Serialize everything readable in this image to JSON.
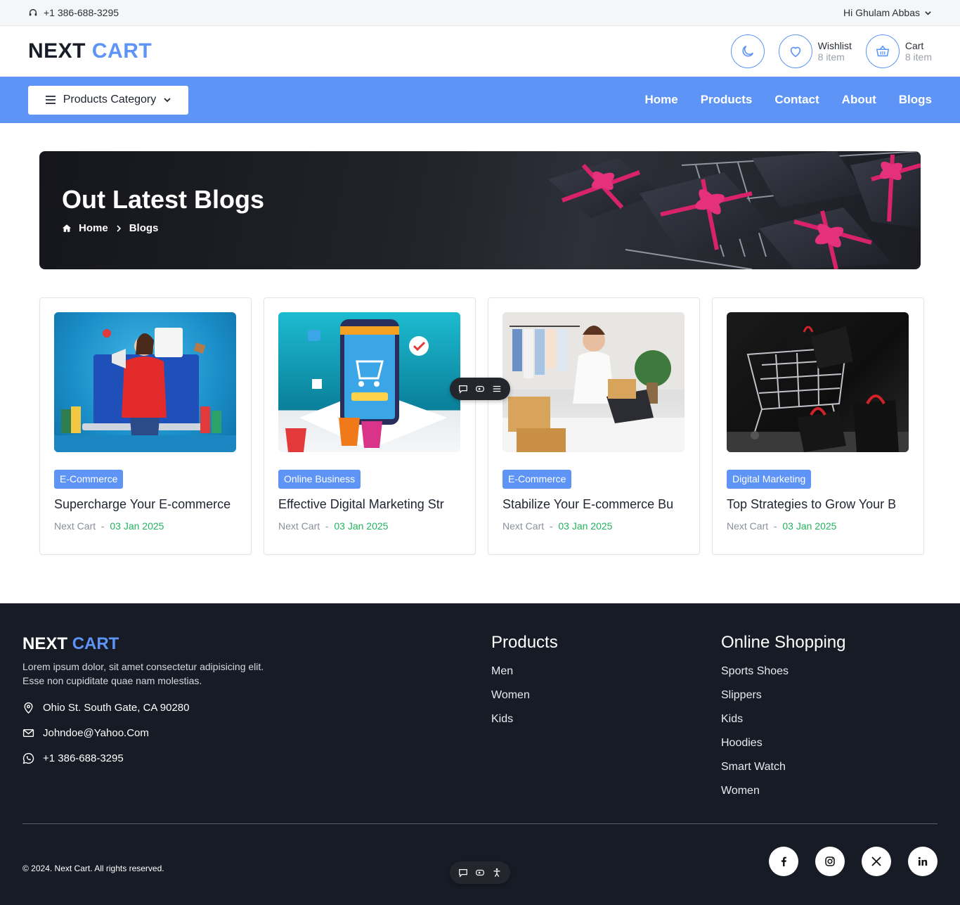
{
  "topbar": {
    "phone": "+1 386-688-3295",
    "greeting": "Hi Ghulam Abbas"
  },
  "header": {
    "logo_part1": "NEXT",
    "logo_part2": "CART",
    "wishlist": {
      "label": "Wishlist",
      "count": "8 item"
    },
    "cart": {
      "label": "Cart",
      "count": "8 item"
    }
  },
  "nav": {
    "category_label": "Products Category",
    "links": [
      "Home",
      "Products",
      "Contact",
      "About",
      "Blogs"
    ]
  },
  "hero": {
    "title": "Out Latest Blogs",
    "crumb_home": "Home",
    "crumb_current": "Blogs"
  },
  "cards": [
    {
      "tag": "E-Commerce",
      "title": "Supercharge Your E-commerce",
      "author": "Next Cart",
      "date": "03 Jan 2025"
    },
    {
      "tag": "Online Business",
      "title": "Effective Digital Marketing Str",
      "author": "Next Cart",
      "date": "03 Jan 2025"
    },
    {
      "tag": "E-Commerce",
      "title": "Stabilize Your E-commerce Bu",
      "author": "Next Cart",
      "date": "03 Jan 2025"
    },
    {
      "tag": "Digital Marketing",
      "title": "Top Strategies to Grow Your B",
      "author": "Next Cart",
      "date": "03 Jan 2025"
    }
  ],
  "footer": {
    "logo_part1": "NEXT",
    "logo_part2": "CART",
    "desc_line1": "Lorem ipsum dolor, sit amet consectetur adipisicing elit.",
    "desc_line2": "Esse non cupiditate quae nam molestias.",
    "address": "Ohio St. South Gate, CA 90280",
    "email": "Johndoe@Yahoo.Com",
    "phone": "+1 386-688-3295",
    "products_title": "Products",
    "products": [
      "Men",
      "Women",
      "Kids"
    ],
    "shopping_title": "Online Shopping",
    "shopping": [
      "Sports Shoes",
      "Slippers",
      "Kids",
      "Hoodies",
      "Smart Watch",
      "Women"
    ],
    "copyright": "© 2024. Next Cart. All rights reserved."
  },
  "colors": {
    "accent": "#5d94f5",
    "footer_bg": "#161b25",
    "date_green": "#22b35e"
  },
  "icons": [
    "headset-icon",
    "chevron-down-icon",
    "moon-icon",
    "heart-icon",
    "basket-icon",
    "menu-icon",
    "home-icon",
    "chevron-right-icon",
    "location-icon",
    "mail-icon",
    "whatsapp-icon",
    "facebook-icon",
    "instagram-icon",
    "x-icon",
    "linkedin-icon",
    "chat-icon",
    "eye-icon",
    "list-icon",
    "accessibility-icon"
  ]
}
